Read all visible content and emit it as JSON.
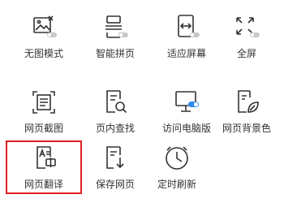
{
  "menu": {
    "items": [
      {
        "label": "无图模式",
        "icon": "no-image-icon",
        "toggle": "off"
      },
      {
        "label": "智能拼页",
        "icon": "page-merge-icon",
        "toggle": "off"
      },
      {
        "label": "适应屏幕",
        "icon": "fit-screen-icon",
        "toggle": "off"
      },
      {
        "label": "全屏",
        "icon": "fullscreen-icon",
        "toggle": "off"
      },
      {
        "label": "网页截图",
        "icon": "screenshot-icon"
      },
      {
        "label": "页内查找",
        "icon": "find-in-page-icon"
      },
      {
        "label": "访问电脑版",
        "icon": "desktop-site-icon",
        "toggle": "on"
      },
      {
        "label": "网页背景色",
        "icon": "leaf-page-icon"
      },
      {
        "label": "网页翻译",
        "icon": "translate-icon",
        "highlighted": true
      },
      {
        "label": "保存网页",
        "icon": "save-page-icon"
      },
      {
        "label": "定时刷新",
        "icon": "timer-refresh-icon"
      }
    ]
  },
  "colors": {
    "icon_stroke": "#333333",
    "toggle_off": "#c8c8c8",
    "toggle_on": "#2f8cf0",
    "highlight_border": "#e02020",
    "text": "#333333"
  }
}
